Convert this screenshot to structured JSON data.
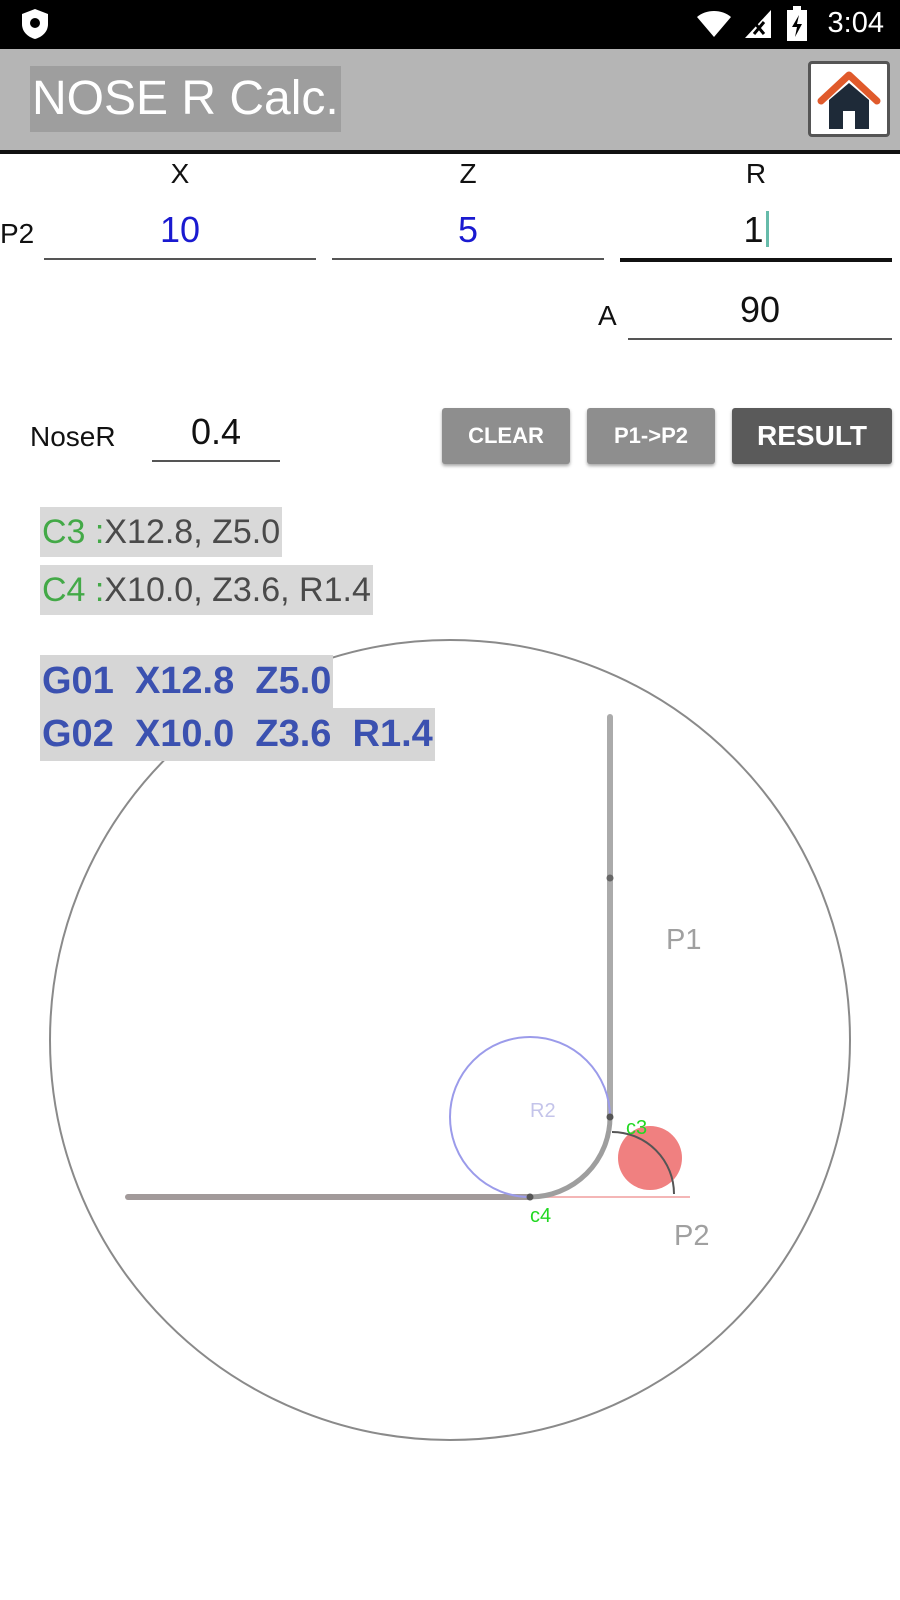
{
  "status_bar": {
    "time": "3:04"
  },
  "app_bar": {
    "title": "NOSE R Calc."
  },
  "inputs": {
    "headers": {
      "x": "X",
      "z": "Z",
      "r": "R"
    },
    "row_label": "P2",
    "x_value": "10",
    "z_value": "5",
    "r_value": "1",
    "a_label": "A",
    "a_value": "90",
    "nose_r_label": "NoseR",
    "nose_r_value": "0.4"
  },
  "buttons": {
    "clear": "CLEAR",
    "p1_p2": "P1->P2",
    "result": "RESULT"
  },
  "results": {
    "c3_key": "C3 :",
    "c3_value": "X12.8, Z5.0",
    "c4_key": "C4 :",
    "c4_value": "X10.0, Z3.6, R1.4"
  },
  "gcode": {
    "line1": "G01  X12.8  Z5.0",
    "line2": "G02  X10.0  Z3.6  R1.4"
  },
  "diagram": {
    "p1_label": "P1",
    "p2_label": "P2",
    "r2_label": "R2",
    "c3_label": "c3",
    "c4_label": "c4"
  },
  "colors": {
    "gcode": "#3b51b0",
    "result_key": "#43a947",
    "input_value": "#1a1ad0",
    "nose_circle": "#f08080",
    "marker_label": "#22d822"
  }
}
